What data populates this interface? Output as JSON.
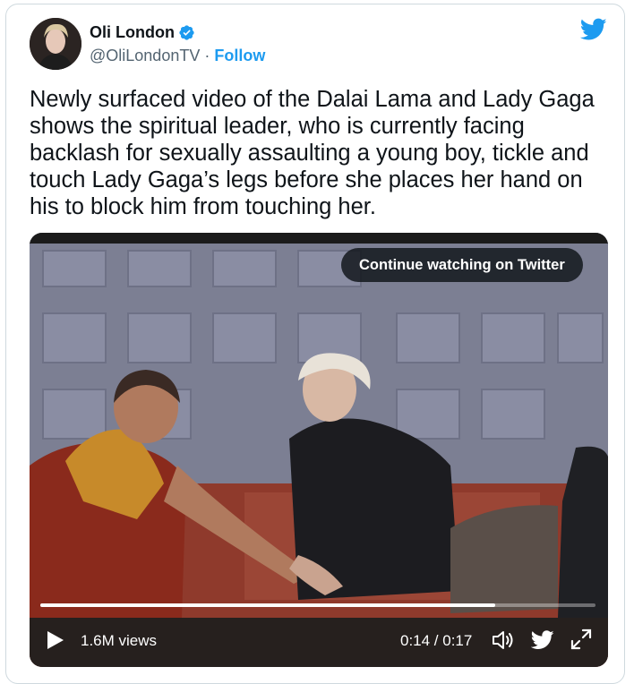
{
  "author": {
    "name": "Oli London",
    "handle": "@OliLondonTV",
    "separator": " · ",
    "follow_label": "Follow",
    "verified_icon": "verified-badge-icon"
  },
  "tweet": {
    "text": "Newly surfaced video of the Dalai Lama and Lady Gaga shows the spiritual leader, who is currently facing backlash for sexually assaulting a young boy, tickle and touch Lady Gaga’s legs before she places her hand on his to block him from touching her."
  },
  "video": {
    "continue_label": "Continue watching on Twitter",
    "views": "1.6M views",
    "time": "0:14 / 0:17",
    "progress": 0.82,
    "icons": [
      "play-icon",
      "volume-icon",
      "twitter-bird-icon",
      "expand-icon"
    ]
  },
  "colors": {
    "brand": "#1d9bf0",
    "text": "#0f1419",
    "muted": "#536471"
  }
}
